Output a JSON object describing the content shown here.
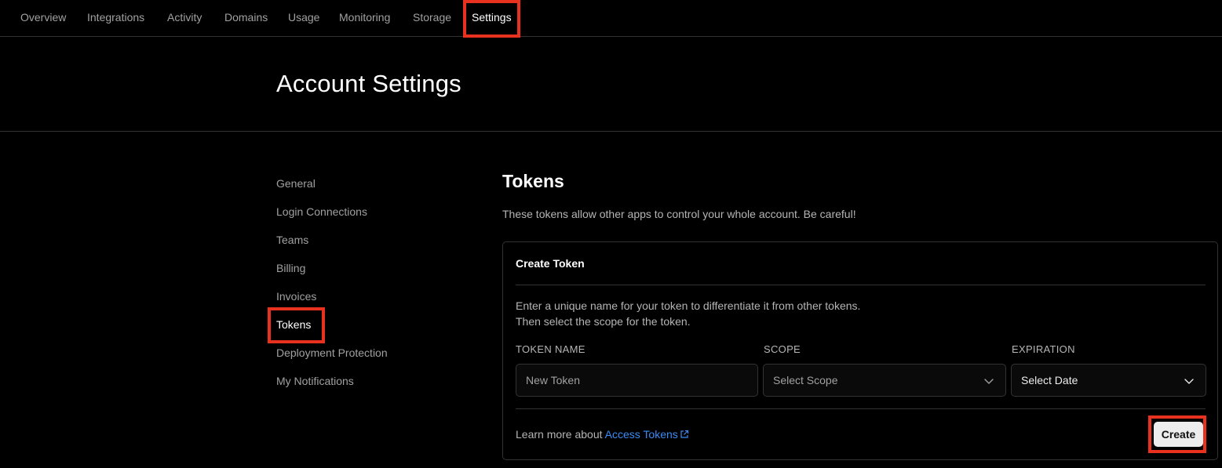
{
  "topnav": {
    "items": [
      {
        "label": "Overview"
      },
      {
        "label": "Integrations"
      },
      {
        "label": "Activity"
      },
      {
        "label": "Domains"
      },
      {
        "label": "Usage"
      },
      {
        "label": "Monitoring"
      },
      {
        "label": "Storage"
      },
      {
        "label": "Settings",
        "active": true
      }
    ]
  },
  "header": {
    "title": "Account Settings"
  },
  "sidebar": {
    "items": [
      {
        "label": "General"
      },
      {
        "label": "Login Connections"
      },
      {
        "label": "Teams"
      },
      {
        "label": "Billing"
      },
      {
        "label": "Invoices"
      },
      {
        "label": "Tokens",
        "active": true
      },
      {
        "label": "Deployment Protection"
      },
      {
        "label": "My Notifications"
      }
    ]
  },
  "main": {
    "title": "Tokens",
    "description": "These tokens allow other apps to control your whole account. Be careful!",
    "card": {
      "title": "Create Token",
      "desc_line1": "Enter a unique name for your token to differentiate it from other tokens.",
      "desc_line2": "Then select the scope for the token.",
      "token_name": {
        "label": "TOKEN NAME",
        "placeholder": "New Token",
        "value": ""
      },
      "scope": {
        "label": "SCOPE",
        "selected": "Select Scope"
      },
      "expiration": {
        "label": "EXPIRATION",
        "selected": "Select Date"
      },
      "learn_prefix": "Learn more about",
      "learn_link": "Access Tokens",
      "create_label": "Create"
    }
  },
  "colors": {
    "background": "#000000",
    "highlight": "#e8311f",
    "link": "#3b8bf5",
    "border": "#333333"
  },
  "icons": [
    "chevron-down-icon",
    "external-link-icon"
  ]
}
